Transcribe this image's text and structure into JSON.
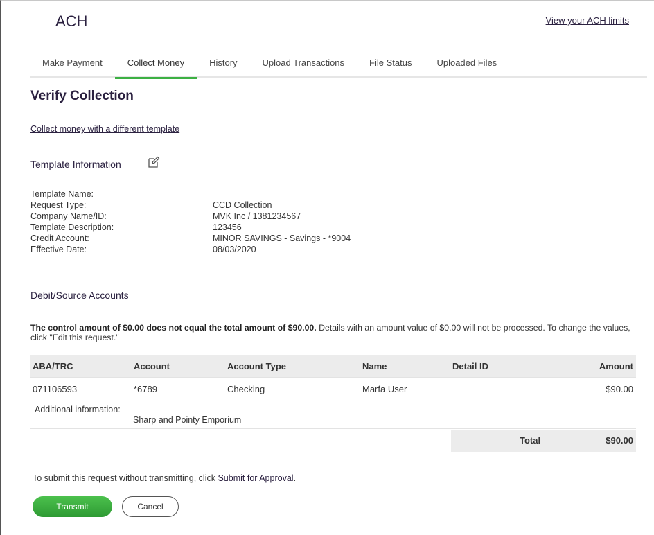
{
  "header": {
    "title": "ACH",
    "limits_link": "View your ACH limits"
  },
  "tabs": [
    {
      "label": "Make Payment"
    },
    {
      "label": "Collect Money",
      "active": true
    },
    {
      "label": "History"
    },
    {
      "label": "Upload Transactions"
    },
    {
      "label": "File Status"
    },
    {
      "label": "Uploaded Files"
    }
  ],
  "page": {
    "title": "Verify Collection",
    "different_template_link": "Collect money with a different template"
  },
  "template_info": {
    "title": "Template Information",
    "edit_icon": "edit-pencil-icon",
    "rows": [
      {
        "label": "Template Name:",
        "value": ""
      },
      {
        "label": "Request Type:",
        "value": "CCD Collection"
      },
      {
        "label": "Company Name/ID:",
        "value": "MVK Inc / 1381234567"
      },
      {
        "label": "Template Description:",
        "value": "123456"
      },
      {
        "label": "Credit Account:",
        "value": "MINOR SAVINGS - Savings - *9004"
      },
      {
        "label": "Effective Date:",
        "value": "08/03/2020"
      }
    ]
  },
  "debit": {
    "title": "Debit/Source Accounts",
    "notice_bold": "The control amount of $0.00 does not equal the total amount of $90.00.",
    "notice_rest": " Details with an amount value of $0.00 will not be processed. To change the values, click \"Edit this request.\"",
    "columns": [
      "ABA/TRC",
      "Account",
      "Account Type",
      "Name",
      "Detail ID",
      "Amount"
    ],
    "rows": [
      {
        "aba": "071106593",
        "account": "*6789",
        "type": "Checking",
        "name": "Marfa User",
        "detail_id": "",
        "amount": "$90.00"
      }
    ],
    "additional_label": "Additional information:",
    "additional_value": "Sharp and Pointy Emporium",
    "total_label": "Total",
    "total_value": "$90.00"
  },
  "footer": {
    "submit_text": "To submit this request without transmitting, click ",
    "submit_link": "Submit for Approval",
    "submit_end": ".",
    "transmit_label": "Transmit",
    "cancel_label": "Cancel"
  },
  "colors": {
    "accent": "#3cb043",
    "heading": "#2b2140",
    "table_header_bg": "#ececec"
  }
}
